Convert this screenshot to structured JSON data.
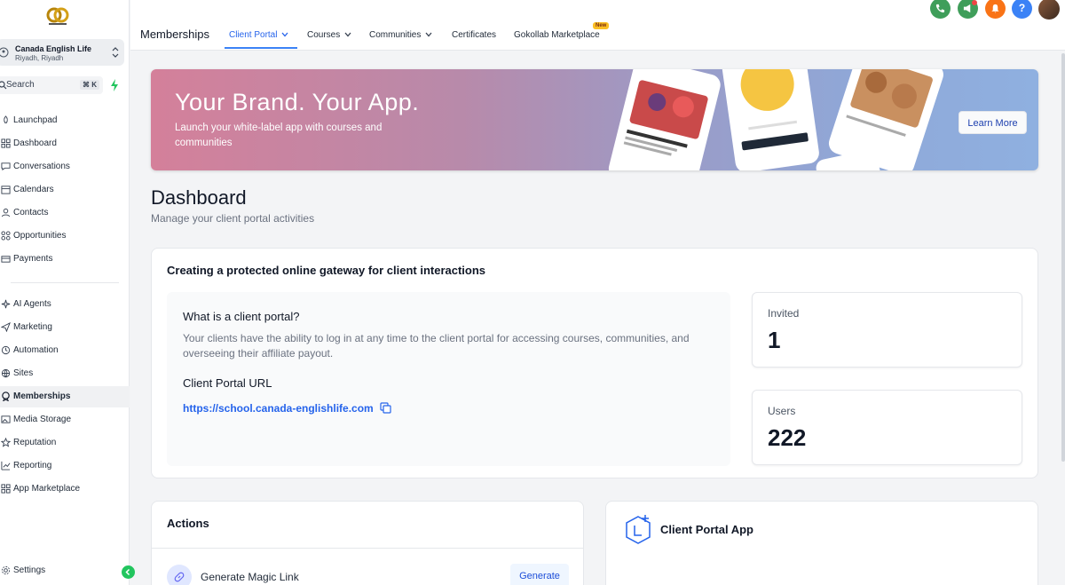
{
  "sidebar": {
    "account": {
      "name": "Canada English Life",
      "location": "Riyadh, Riyadh"
    },
    "search": {
      "placeholder": "Search",
      "shortcut": "⌘ K"
    },
    "items": [
      {
        "label": "Launchpad",
        "icon": "rocket-icon"
      },
      {
        "label": "Dashboard",
        "icon": "dashboard-icon"
      },
      {
        "label": "Conversations",
        "icon": "chat-icon"
      },
      {
        "label": "Calendars",
        "icon": "calendar-icon"
      },
      {
        "label": "Contacts",
        "icon": "contacts-icon"
      },
      {
        "label": "Opportunities",
        "icon": "opportunities-icon"
      },
      {
        "label": "Payments",
        "icon": "payments-icon"
      },
      {
        "label": "AI Agents",
        "icon": "sparkle-icon"
      },
      {
        "label": "Marketing",
        "icon": "send-icon"
      },
      {
        "label": "Automation",
        "icon": "automation-icon"
      },
      {
        "label": "Sites",
        "icon": "globe-icon"
      },
      {
        "label": "Memberships",
        "icon": "memberships-icon",
        "active": true
      },
      {
        "label": "Media Storage",
        "icon": "image-icon"
      },
      {
        "label": "Reputation",
        "icon": "star-icon"
      },
      {
        "label": "Reporting",
        "icon": "chart-icon"
      },
      {
        "label": "App Marketplace",
        "icon": "grid-icon"
      }
    ],
    "settings": "Settings"
  },
  "topbar": {
    "title": "Memberships",
    "tabs": [
      {
        "label": "Client Portal",
        "dropdown": true,
        "active": true
      },
      {
        "label": "Courses",
        "dropdown": true
      },
      {
        "label": "Communities",
        "dropdown": true
      },
      {
        "label": "Certificates",
        "dropdown": false
      },
      {
        "label": "Gokollab Marketplace",
        "dropdown": false,
        "badge": "New"
      }
    ],
    "colors": {
      "phone": "#3f9e5a",
      "megaphone": "#3f9e5a",
      "bell": "#f97316",
      "help": "#3b82f6"
    }
  },
  "banner": {
    "title": "Your Brand. Your App.",
    "subtitle": "Launch your white-label app with courses and communities",
    "cta": "Learn More"
  },
  "dashboard": {
    "title": "Dashboard",
    "subtitle": "Manage your client portal activities"
  },
  "main_card": {
    "title": "Creating a protected online gateway for client interactions",
    "question": "What is a client portal?",
    "description": "Your clients have the ability to log in at any time to the client portal for accessing courses, communities, and overseeing their affiliate payout.",
    "url_label": "Client Portal URL",
    "url": "https://school.canada-englishlife.com",
    "stats": [
      {
        "label": "Invited",
        "value": "1"
      },
      {
        "label": "Users",
        "value": "222"
      }
    ]
  },
  "actions": {
    "title": "Actions",
    "items": [
      {
        "label": "Generate Magic Link",
        "button": "Generate"
      }
    ]
  },
  "app_card": {
    "title": "Client Portal App"
  }
}
